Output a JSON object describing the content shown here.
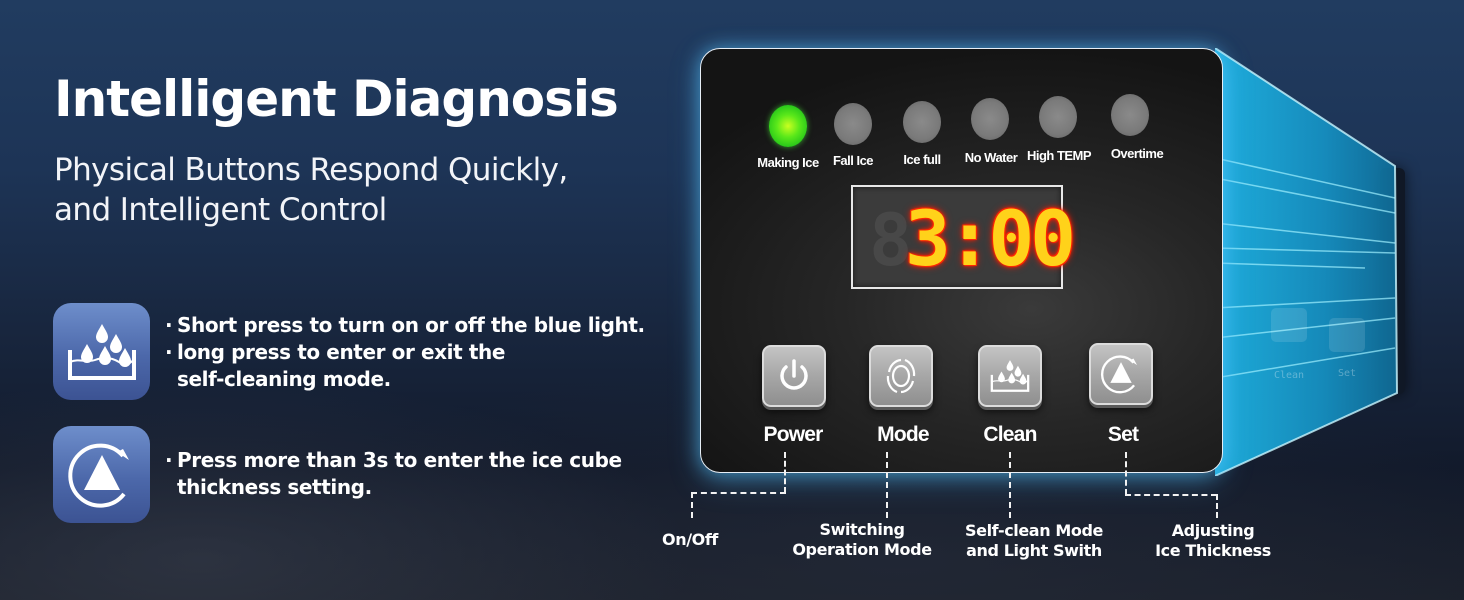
{
  "header": {
    "title": "Intelligent Diagnosis",
    "subtitle_lines": [
      "Physical Buttons Respond Quickly,",
      "and Intelligent Control"
    ]
  },
  "features": [
    {
      "icon": "clean-basin-drops-icon",
      "bullets": [
        {
          "bullet": "·",
          "lines": [
            "Short press to turn on or off the blue light."
          ]
        },
        {
          "bullet": "·",
          "lines": [
            "long press to enter or exit the",
            "self-cleaning mode."
          ]
        }
      ]
    },
    {
      "icon": "set-triangle-rotate-icon",
      "bullets": [
        {
          "bullet": "·",
          "lines": [
            "Press more than 3s to enter the ice cube",
            "thickness setting."
          ]
        }
      ]
    }
  ],
  "panel": {
    "indicators": [
      {
        "label": "Making Ice",
        "state": "on",
        "color": "#3fdc1a"
      },
      {
        "label": "Fall Ice",
        "state": "off",
        "color": "#808080"
      },
      {
        "label": "Ice full",
        "state": "off",
        "color": "#808080"
      },
      {
        "label": "No Water",
        "state": "off",
        "color": "#808080"
      },
      {
        "label": "High TEMP",
        "state": "off",
        "color": "#808080"
      },
      {
        "label": "Overtime",
        "state": "off",
        "color": "#808080"
      }
    ],
    "display": {
      "ghost_digit": "8",
      "value": "3:00",
      "color": "#ffd21a",
      "glow": "#ff2200"
    },
    "buttons": [
      {
        "label": "Power",
        "icon": "power-icon",
        "description": "On/Off"
      },
      {
        "label": "Mode",
        "icon": "mode-cycle-icon",
        "description_lines": [
          "Switching",
          "Operation Mode"
        ]
      },
      {
        "label": "Clean",
        "icon": "clean-basin-drops-icon",
        "description_lines": [
          "Self-clean Mode",
          "and Light Swith"
        ]
      },
      {
        "label": "Set",
        "icon": "set-triangle-rotate-icon",
        "description_lines": [
          "Adjusting",
          "Ice Thickness"
        ]
      }
    ]
  },
  "side_reflection": {
    "labels": [
      "Clean",
      "Set"
    ]
  },
  "colors": {
    "background_top": "#213c60",
    "background_bottom": "#121a2b",
    "icon_tile": "#4c68aa",
    "panel_glow": "#5ac8ff"
  }
}
